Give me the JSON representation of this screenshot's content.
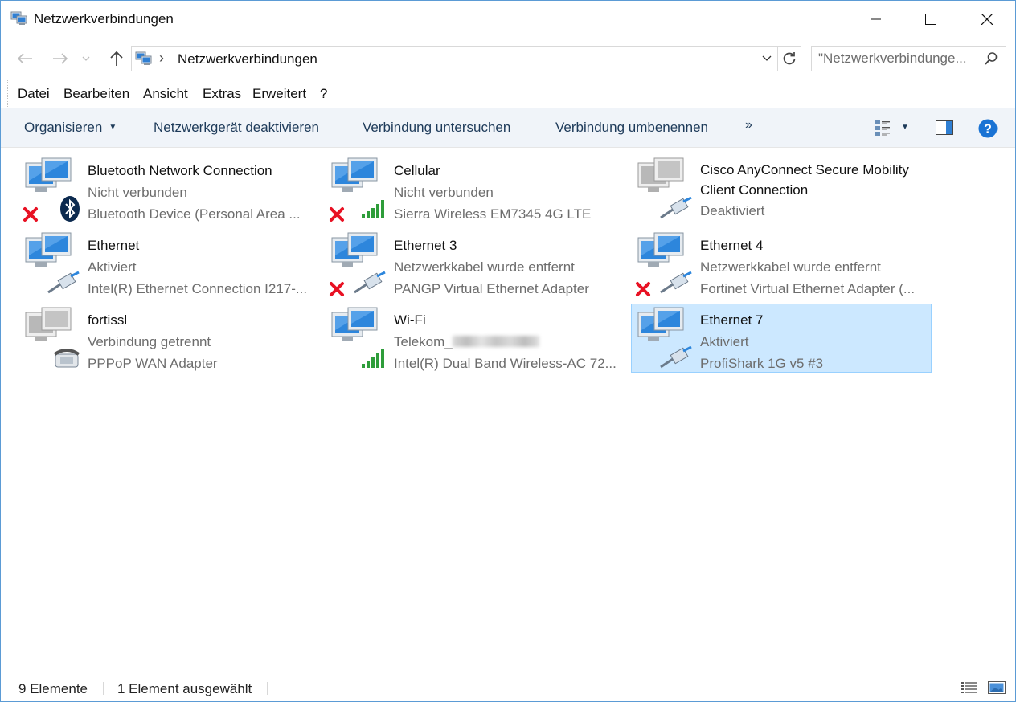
{
  "window": {
    "title": "Netzwerkverbindungen",
    "icon": "network-connections-icon"
  },
  "address": {
    "path": "Netzwerkverbindungen",
    "search_placeholder": "\"Netzwerkverbindunge..."
  },
  "menu": {
    "items": [
      "Datei",
      "Bearbeiten",
      "Ansicht",
      "Extras",
      "Erweitert",
      "?"
    ]
  },
  "commands": {
    "organize": "Organisieren",
    "disable": "Netzwerkgerät deaktivieren",
    "diagnose": "Verbindung untersuchen",
    "rename": "Verbindung umbenennen",
    "more": "»"
  },
  "connections": [
    {
      "name": "Bluetooth Network Connection",
      "status": "Nicht verbunden",
      "device": "Bluetooth Device (Personal Area ...",
      "badge": "bluetooth",
      "error": true
    },
    {
      "name": "Cellular",
      "status": "Nicht verbunden",
      "device": "Sierra Wireless EM7345 4G LTE",
      "badge": "signal",
      "error": true
    },
    {
      "name": "Cisco AnyConnect Secure Mobility Client Connection",
      "status": "Deaktiviert",
      "device": "",
      "badge": "cable",
      "error": false
    },
    {
      "name": "Ethernet",
      "status": "Aktiviert",
      "device": "Intel(R) Ethernet Connection I217-...",
      "badge": "cable",
      "error": false
    },
    {
      "name": "Ethernet 3",
      "status": "Netzwerkkabel wurde entfernt",
      "device": "PANGP Virtual Ethernet Adapter",
      "badge": "cable",
      "error": true
    },
    {
      "name": "Ethernet 4",
      "status": "Netzwerkkabel wurde entfernt",
      "device": "Fortinet Virtual Ethernet Adapter (...",
      "badge": "cable",
      "error": true
    },
    {
      "name": "fortissl",
      "status": "Verbindung getrennt",
      "device": "PPPoP WAN Adapter",
      "badge": "phone",
      "error": false
    },
    {
      "name": "Wi-Fi",
      "status": "Telekom_",
      "device": "Intel(R) Dual Band Wireless-AC 72...",
      "badge": "signal",
      "error": false
    },
    {
      "name": "Ethernet 7",
      "status": "Aktiviert",
      "device": "ProfiShark 1G v5 #3",
      "badge": "cable",
      "error": false,
      "selected": true
    }
  ],
  "status": {
    "count": "9 Elemente",
    "selected": "1 Element ausgewählt"
  },
  "colors": {
    "selection": "#cce8ff",
    "selection_border": "#99d1ff",
    "help": "#1a73d4",
    "error": "#e81123"
  }
}
